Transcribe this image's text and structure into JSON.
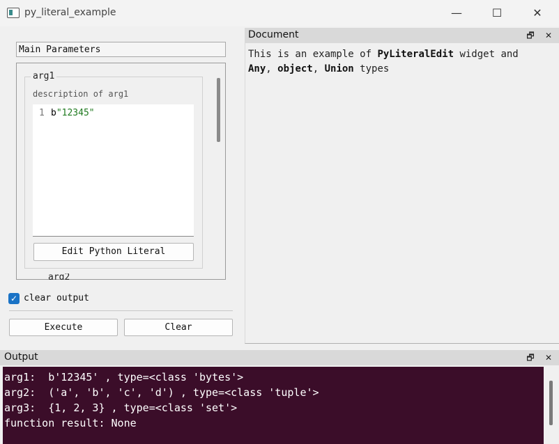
{
  "window": {
    "title": "py_literal_example",
    "minimize_glyph": "—",
    "maximize_glyph": "☐",
    "close_glyph": "✕"
  },
  "left_panel": {
    "main_parameters_label": "Main Parameters",
    "arg1": {
      "title": "arg1",
      "description": "description of arg1",
      "line_number": "1",
      "code_prefix": "b",
      "code_string": "\"12345\"",
      "edit_button_label": "Edit Python Literal"
    },
    "arg2_partial_title": "arg2",
    "clear_output": {
      "label": "clear output",
      "checked": true,
      "check_glyph": "✓"
    },
    "execute_button_label": "Execute",
    "clear_button_label": "Clear"
  },
  "document": {
    "title": "Document",
    "float_glyph": "🗗",
    "close_glyph": "✕",
    "text_1": "This is an example of ",
    "bold_1": "PyLiteralEdit",
    "text_2": " widget and",
    "bold_2": "Any",
    "text_3": ", ",
    "bold_3": "object",
    "text_4": ", ",
    "bold_4": "Union",
    "text_5": " types"
  },
  "output": {
    "title": "Output",
    "float_glyph": "🗗",
    "close_glyph": "✕",
    "lines": [
      "arg1:  b'12345' , type=<class 'bytes'>",
      "arg2:  ('a', 'b', 'c', 'd') , type=<class 'tuple'>",
      "arg3:  {1, 2, 3} , type=<class 'set'>",
      "function result: None"
    ]
  },
  "colors": {
    "output_bg": "#3b0d29",
    "checkbox_accent": "#1a73c6",
    "string_literal": "#1f7a1f"
  }
}
